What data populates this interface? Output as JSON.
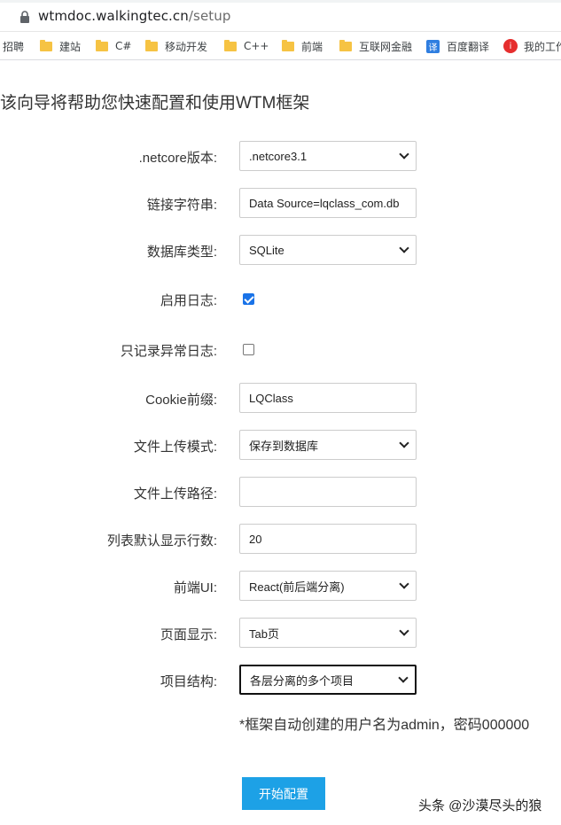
{
  "browser": {
    "url_host": "wtmdoc.walkingtec.cn",
    "url_path": "/setup",
    "bookmarks": [
      {
        "label": "招聘",
        "icon": "none"
      },
      {
        "label": "建站",
        "icon": "folder-icon"
      },
      {
        "label": "C#",
        "icon": "folder-icon"
      },
      {
        "label": "移动开发",
        "icon": "folder-icon"
      },
      {
        "label": "C++",
        "icon": "folder-icon"
      },
      {
        "label": "前端",
        "icon": "folder-icon"
      },
      {
        "label": "互联网金融",
        "icon": "folder-icon"
      },
      {
        "label": "百度翻译",
        "icon": "translate-icon",
        "glyph": "译"
      },
      {
        "label": "我的工作",
        "icon": "red-circle-icon",
        "glyph": "i"
      }
    ]
  },
  "page": {
    "intro": "该向导将帮助您快速配置和使用WTM框架",
    "fields": {
      "netcore": {
        "label": ".netcore版本:",
        "value": ".netcore3.1"
      },
      "conn": {
        "label": "链接字符串:",
        "value": "Data Source=lqclass_com.db"
      },
      "dbtype": {
        "label": "数据库类型:",
        "value": "SQLite"
      },
      "log": {
        "label": "启用日志:",
        "checked": true
      },
      "errlog": {
        "label": "只记录异常日志:",
        "checked": false
      },
      "cookie": {
        "label": "Cookie前缀:",
        "value": "LQClass"
      },
      "upload_mode": {
        "label": "文件上传模式:",
        "value": "保存到数据库"
      },
      "upload_path": {
        "label": "文件上传路径:",
        "value": ""
      },
      "page_rows": {
        "label": "列表默认显示行数:",
        "value": "20"
      },
      "ui": {
        "label": "前端UI:",
        "value": "React(前后端分离)"
      },
      "page_display": {
        "label": "页面显示:",
        "value": "Tab页"
      },
      "structure": {
        "label": "项目结构:",
        "value": "各层分离的多个项目"
      }
    },
    "note": "*框架自动创建的用户名为admin，密码000000",
    "start_button": "开始配置",
    "watermark": "头条 @沙漠尽头的狼"
  },
  "colors": {
    "accent_button": "#1da1e6",
    "checkbox_on": "#1a73e8",
    "folder": "#f6c343"
  }
}
